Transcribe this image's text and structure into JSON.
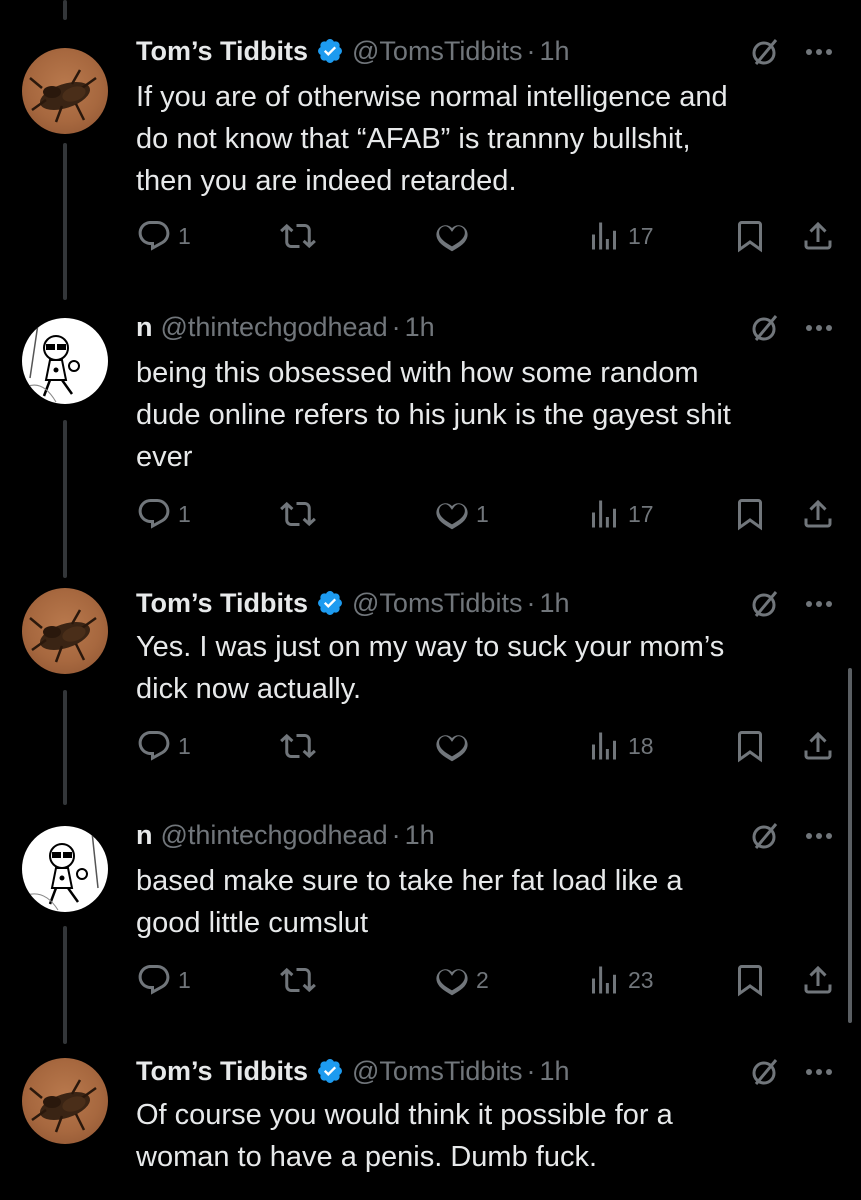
{
  "tweets": [
    {
      "author": "tom",
      "display_name": "Tom’s Tidbits",
      "verified": true,
      "handle": "@TomsTidbits",
      "dot": "·",
      "time": "1h",
      "text_lines": [
        "If you are of otherwise normal intelligence and",
        "do not know that “AFAB” is trannny bullshit,",
        "then you are indeed retarded."
      ],
      "replies": "1",
      "retweets": "",
      "likes": "",
      "views": "17"
    },
    {
      "author": "n",
      "display_name": "n",
      "verified": false,
      "handle": "@thintechgodhead",
      "dot": "·",
      "time": "1h",
      "text_lines": [
        "being this obsessed with how some random",
        "dude online refers to his junk is the gayest shit",
        "ever"
      ],
      "replies": "1",
      "retweets": "",
      "likes": "1",
      "views": "17"
    },
    {
      "author": "tom",
      "display_name": "Tom’s Tidbits",
      "verified": true,
      "handle": "@TomsTidbits",
      "dot": "·",
      "time": "1h",
      "text_lines": [
        "Yes. I was just on my way to suck your mom’s",
        "dick now actually."
      ],
      "replies": "1",
      "retweets": "",
      "likes": "",
      "views": "18"
    },
    {
      "author": "n",
      "display_name": "n",
      "verified": false,
      "handle": "@thintechgodhead",
      "dot": "·",
      "time": "1h",
      "text_lines": [
        "based make sure to take her fat load like a",
        "good little cumslut"
      ],
      "replies": "1",
      "retweets": "",
      "likes": "2",
      "views": "23"
    },
    {
      "author": "tom",
      "display_name": "Tom’s Tidbits",
      "verified": true,
      "handle": "@TomsTidbits",
      "dot": "·",
      "time": "1h",
      "text_lines": [
        "Of course you would think it possible for a",
        "woman to have a penis. Dumb fuck."
      ]
    }
  ],
  "colors": {
    "background": "#000000",
    "text": "#e7e9ea",
    "secondary": "#71767b",
    "verified_blue": "#1d9bf0",
    "thread_line": "#333639"
  },
  "icons": {
    "verified": "verified-badge-icon",
    "grok": "grok-icon",
    "more": "more-dots-icon",
    "reply": "reply-icon",
    "retweet": "retweet-icon",
    "like": "like-icon",
    "views": "views-icon",
    "bookmark": "bookmark-icon",
    "share": "share-icon"
  }
}
